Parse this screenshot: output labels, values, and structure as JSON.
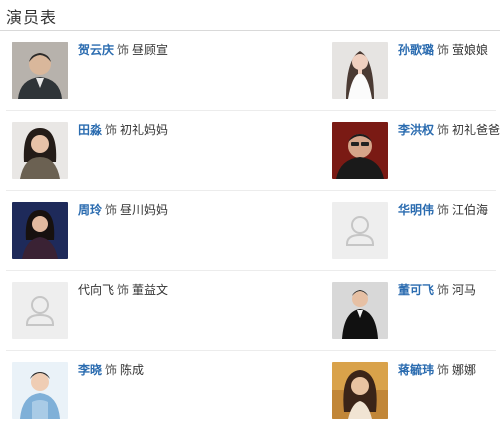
{
  "header": {
    "title": "演员表"
  },
  "cast": [
    {
      "actor": "贺云庆",
      "sep": "饰",
      "role": "昼顾宣",
      "linked": true,
      "photo": "photo-icon"
    },
    {
      "actor": "孙歌璐",
      "sep": "饰",
      "role": "萤娘娘",
      "linked": true,
      "photo": "photo-icon"
    },
    {
      "actor": "田淼",
      "sep": "饰",
      "role": "初礼妈妈",
      "linked": true,
      "photo": "photo-icon"
    },
    {
      "actor": "李洪权",
      "sep": "饰",
      "role": "初礼爸爸",
      "linked": true,
      "photo": "photo-icon"
    },
    {
      "actor": "周玲",
      "sep": "饰",
      "role": "昼川妈妈",
      "linked": true,
      "photo": "photo-icon"
    },
    {
      "actor": "华明伟",
      "sep": "饰",
      "role": "江伯海",
      "linked": true,
      "photo": "placeholder-avatar-icon"
    },
    {
      "actor": "代向飞",
      "sep": "饰",
      "role": "董益文",
      "linked": false,
      "photo": "placeholder-avatar-icon"
    },
    {
      "actor": "董可飞",
      "sep": "饰",
      "role": "河马",
      "linked": true,
      "photo": "photo-icon"
    },
    {
      "actor": "李晓",
      "sep": "饰",
      "role": "陈成",
      "linked": true,
      "photo": "photo-icon"
    },
    {
      "actor": "蒋毓玮",
      "sep": "饰",
      "role": "娜娜",
      "linked": true,
      "photo": "photo-icon"
    }
  ],
  "colors": {
    "link": "#2b6cb0",
    "divider": "#ececec",
    "placeholder_bg": "#eeeeee"
  }
}
